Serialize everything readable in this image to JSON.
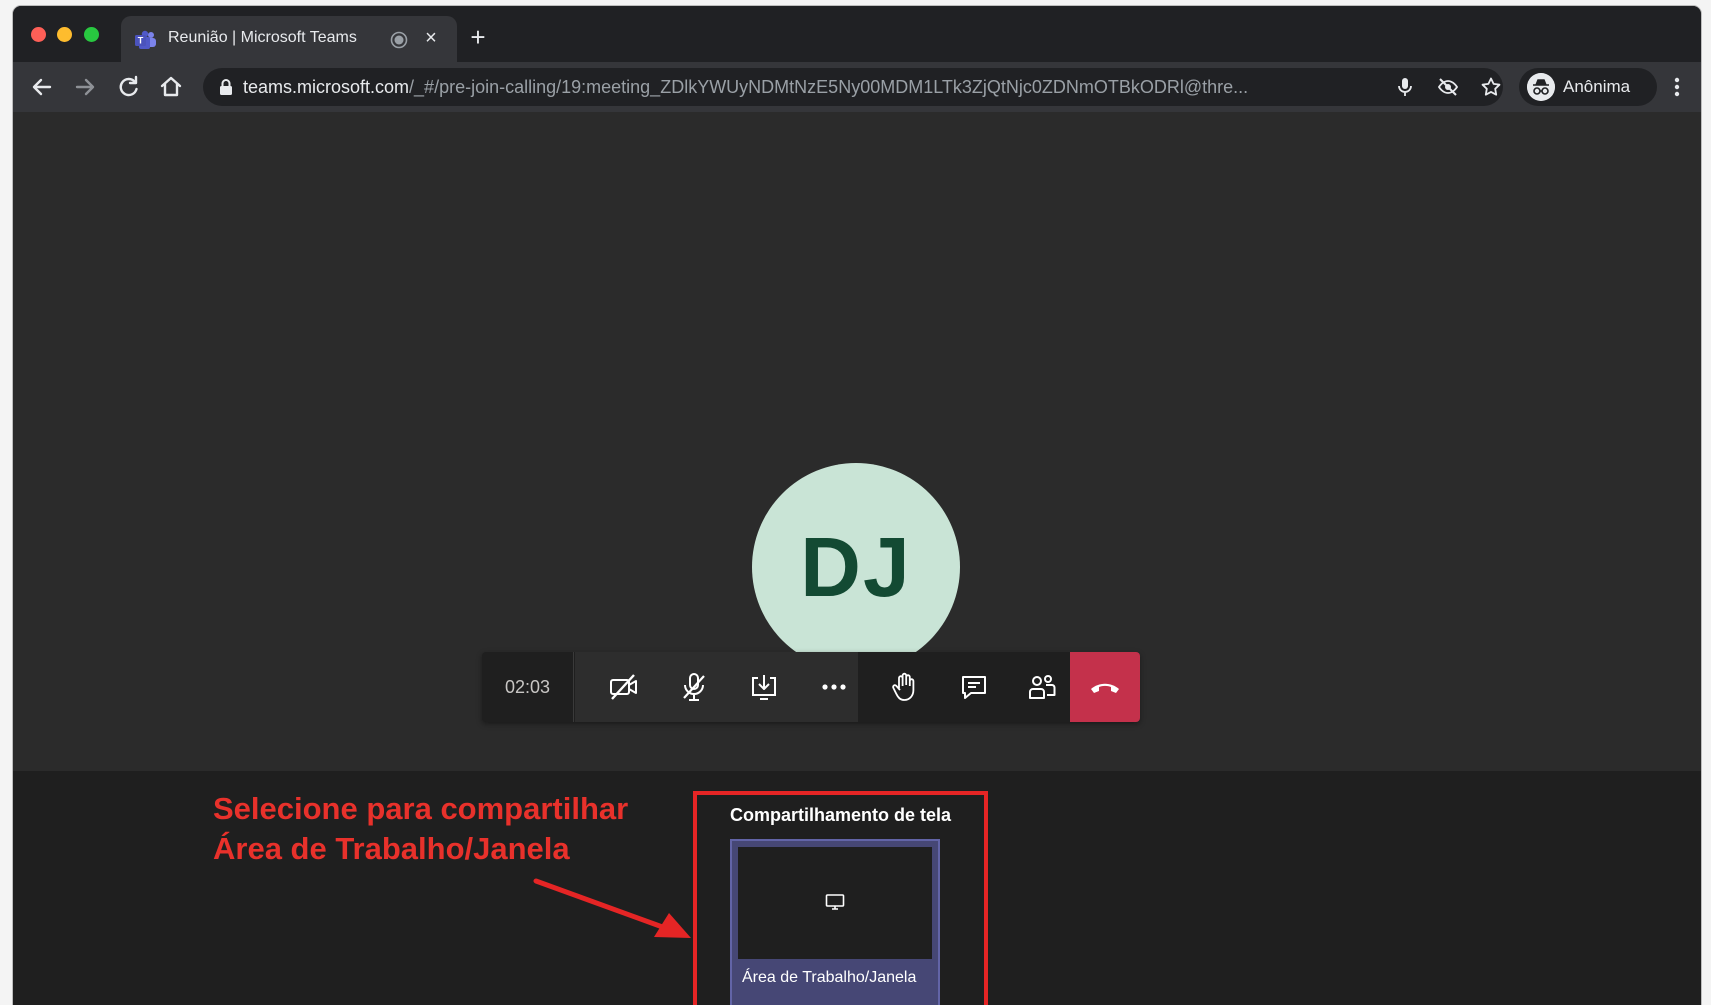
{
  "browser": {
    "tab": {
      "title": "Reunião | Microsoft Teams",
      "favicon": "teams-icon",
      "audio_indicator": "recording-dot-icon",
      "close_label": "×"
    },
    "new_tab_label": "+",
    "toolbar": {
      "back": "back-arrow-icon",
      "forward": "forward-arrow-icon",
      "reload": "reload-icon",
      "home": "home-icon"
    },
    "address": {
      "host": "teams.microsoft.com",
      "path": "/_#/pre-join-calling/19:meeting_ZDlkYWUyNDMtNzE5Ny00MDM1LTk3ZjQtNjc0ZDNmOTBkODRl@thre..."
    },
    "omnibox_icons": [
      "microphone-icon",
      "eye-off-icon",
      "star-icon"
    ],
    "profile": {
      "label": "Anônima",
      "icon": "incognito-icon"
    },
    "menu": "kebab-menu-icon"
  },
  "meeting": {
    "participant_initials": "DJ",
    "timer": "02:03",
    "controls": [
      {
        "name": "camera-off-button",
        "icon": "camera-off-icon"
      },
      {
        "name": "mic-off-button",
        "icon": "mic-off-icon"
      },
      {
        "name": "share-screen-button",
        "icon": "share-tray-icon"
      },
      {
        "name": "more-actions-button",
        "icon": "ellipsis-icon"
      },
      {
        "name": "raise-hand-button",
        "icon": "hand-icon"
      },
      {
        "name": "chat-button",
        "icon": "chat-icon"
      },
      {
        "name": "participants-button",
        "icon": "people-icon"
      },
      {
        "name": "hang-up-button",
        "icon": "phone-hangup-icon"
      }
    ],
    "colors": {
      "hangup": "#c4314b",
      "avatar_bg": "#c9e4d6",
      "avatar_text": "#134a33",
      "share_card": "#464775"
    }
  },
  "share_tray": {
    "title": "Compartilhamento de tela",
    "option_label": "Área de Trabalho/Janela",
    "option_icon": "monitor-icon"
  },
  "annotation": {
    "line1": "Selecione para compartilhar",
    "line2": "Área de Trabalho/Janela",
    "color": "#e8312b"
  }
}
